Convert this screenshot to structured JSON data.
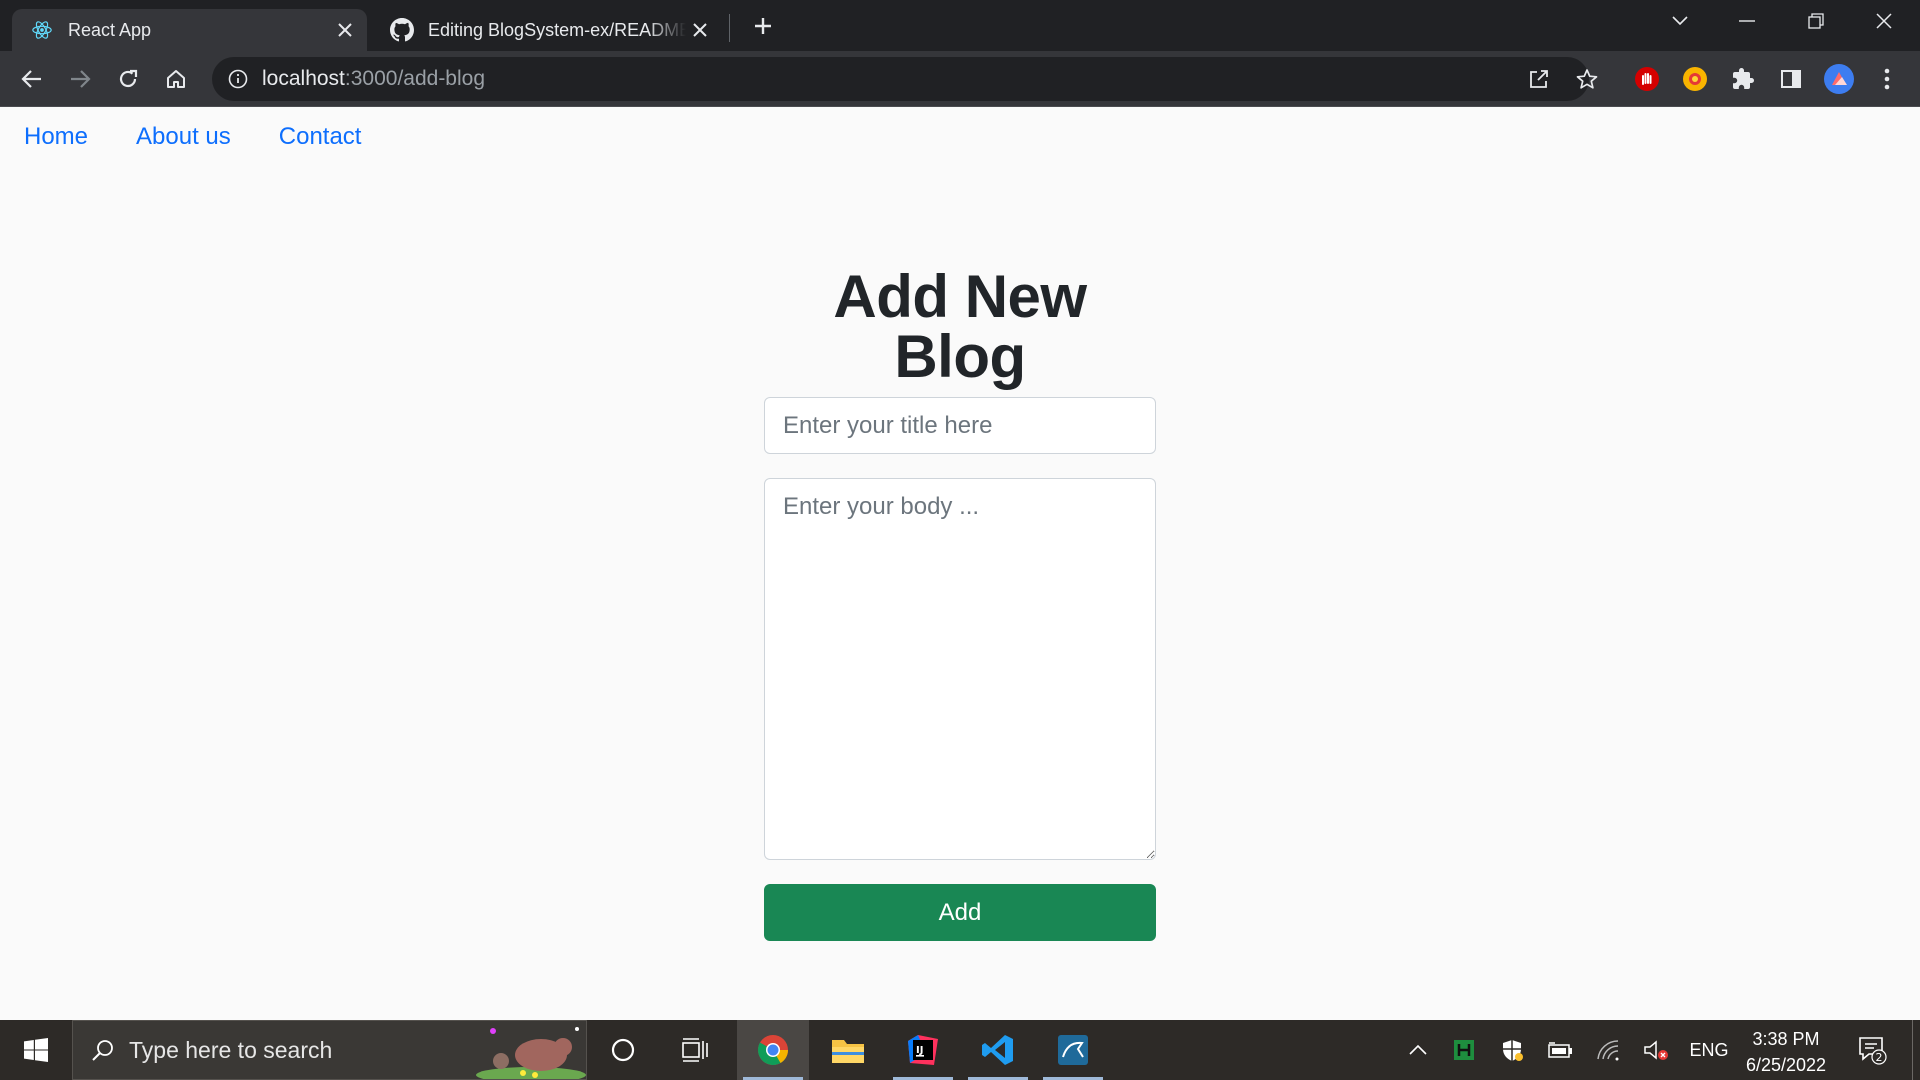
{
  "browser": {
    "tabs": [
      {
        "title": "React App",
        "active": true,
        "icon": "react-icon"
      },
      {
        "title": "Editing BlogSystem-ex/README.md",
        "active": false,
        "icon": "github-icon"
      }
    ],
    "address": {
      "host": "localhost",
      "path": ":3000/add-blog"
    }
  },
  "nav": {
    "home": "Home",
    "about": "About us",
    "contact": "Contact"
  },
  "form": {
    "heading": "Add New Blog",
    "title_placeholder": "Enter your title here",
    "body_placeholder": "Enter your body ...",
    "add_label": "Add"
  },
  "taskbar": {
    "search_placeholder": "Type here to search",
    "language": "ENG",
    "time": "3:38 PM",
    "date": "6/25/2022",
    "notification_count": "2"
  },
  "colors": {
    "link": "#0d6efd",
    "primary_button": "#198754",
    "heading": "#212529"
  }
}
